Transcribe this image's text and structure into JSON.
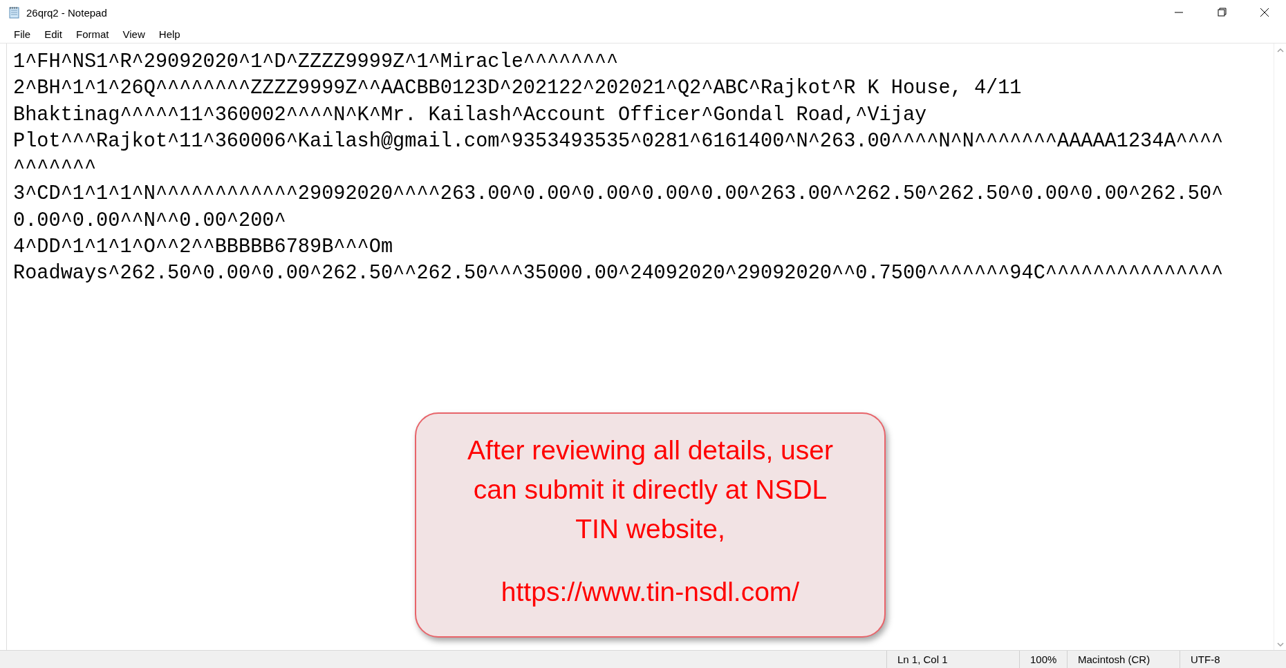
{
  "window": {
    "title": "26qrq2 - Notepad"
  },
  "menu": [
    {
      "label": "File"
    },
    {
      "label": "Edit"
    },
    {
      "label": "Format"
    },
    {
      "label": "View"
    },
    {
      "label": "Help"
    }
  ],
  "editor": {
    "lines": [
      "1^FH^NS1^R^29092020^1^D^ZZZZ9999Z^1^Miracle^^^^^^^^",
      "2^BH^1^1^26Q^^^^^^^^ZZZZ9999Z^^AACBB0123D^202122^202021^Q2^ABC^Rajkot^R K House, 4/11",
      "Bhaktinag^^^^^11^360002^^^^N^K^Mr. Kailash^Account Officer^Gondal Road,^Vijay",
      "Plot^^^Rajkot^11^360006^Kailash@gmail.com^9353493535^0281^6161400^N^263.00^^^^N^N^^^^^^^AAAAA1234A^^^^",
      "^^^^^^^",
      "3^CD^1^1^1^N^^^^^^^^^^^^29092020^^^^263.00^0.00^0.00^0.00^0.00^263.00^^262.50^262.50^0.00^0.00^262.50^",
      "0.00^0.00^^N^^0.00^200^",
      "4^DD^1^1^1^O^^2^^BBBBB6789B^^^Om",
      "Roadways^262.50^0.00^0.00^262.50^^262.50^^^35000.00^24092020^29092020^^0.7500^^^^^^^94C^^^^^^^^^^^^^^^"
    ]
  },
  "callout": {
    "text": "After reviewing all details, user can submit it directly at NSDL TIN website,",
    "link": "https://www.tin-nsdl.com/"
  },
  "status_bar": {
    "position": "Ln 1, Col 1",
    "zoom": "100%",
    "line_ending": "Macintosh (CR)",
    "encoding": "UTF-8"
  }
}
